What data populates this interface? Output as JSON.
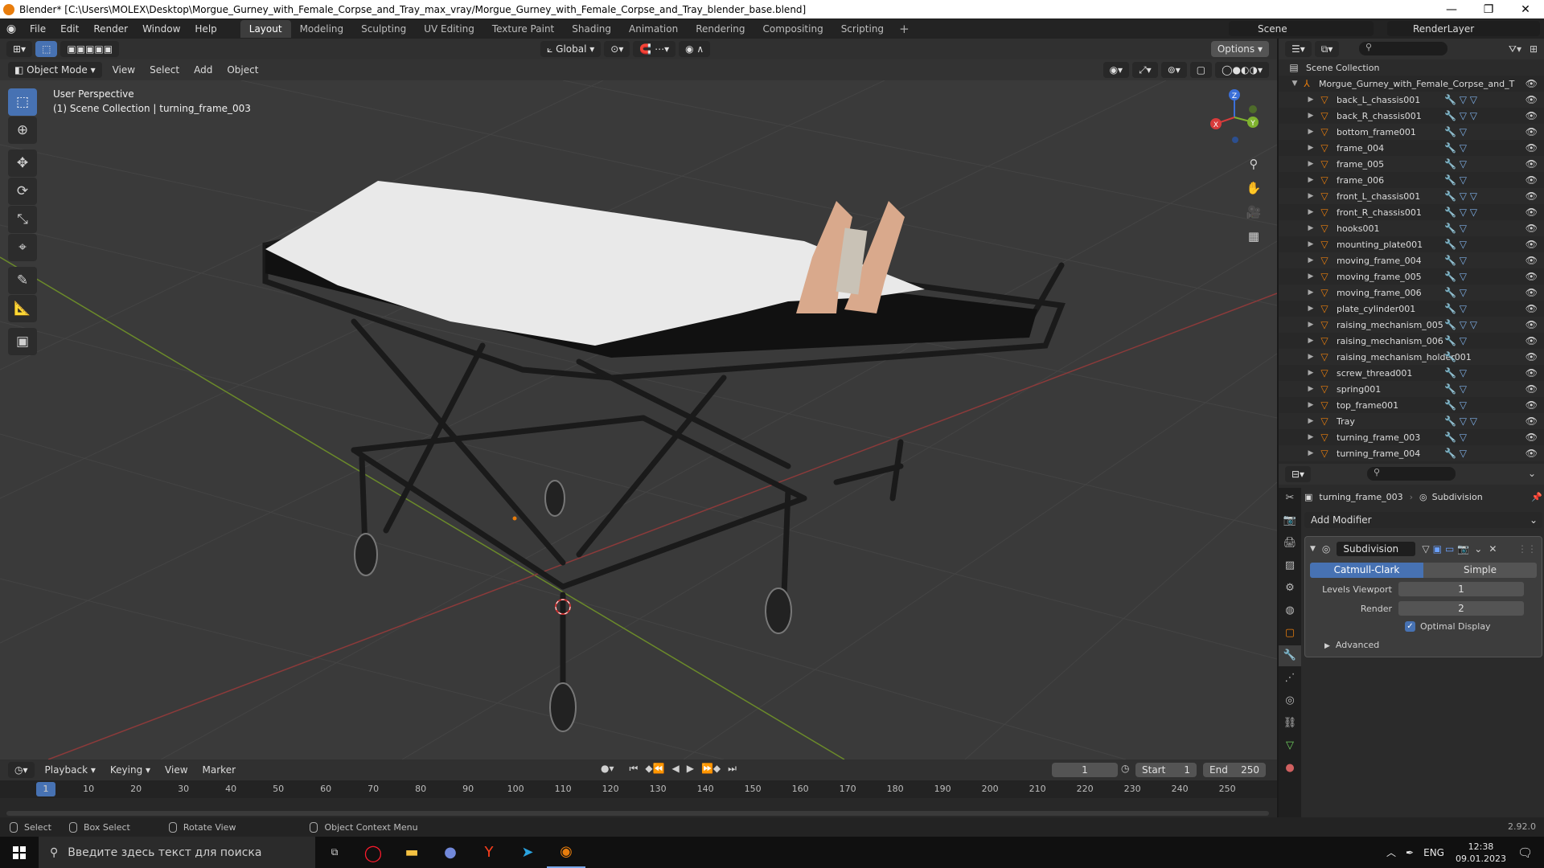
{
  "window": {
    "title": "Blender* [C:\\Users\\MOLEX\\Desktop\\Morgue_Gurney_with_Female_Corpse_and_Tray_max_vray/Morgue_Gurney_with_Female_Corpse_and_Tray_blender_base.blend]",
    "minimize": "—",
    "maximize": "❐",
    "close": "✕"
  },
  "menu": [
    "File",
    "Edit",
    "Render",
    "Window",
    "Help"
  ],
  "workspaces": [
    "Layout",
    "Modeling",
    "Sculpting",
    "UV Editing",
    "Texture Paint",
    "Shading",
    "Animation",
    "Rendering",
    "Compositing",
    "Scripting"
  ],
  "scene": "Scene",
  "render_layer": "RenderLayer",
  "viewport": {
    "mode": "Object Mode",
    "menus": [
      "View",
      "Select",
      "Add",
      "Object"
    ],
    "transform_orientation": "Global",
    "options": "Options",
    "perspective": "User Perspective",
    "collection_info": "(1) Scene Collection | turning_frame_003"
  },
  "gizmo": {
    "x": "X",
    "y": "Y",
    "z": "Z"
  },
  "outliner": {
    "root": "Scene Collection",
    "collection": "Morgue_Gurney_with_Female_Corpse_and_T",
    "items": [
      {
        "name": "back_L_chassis001",
        "mods": "🔧 ▽ ▽"
      },
      {
        "name": "back_R_chassis001",
        "mods": "🔧 ▽ ▽"
      },
      {
        "name": "bottom_frame001",
        "mods": "🔧 ▽"
      },
      {
        "name": "frame_004",
        "mods": "🔧 ▽"
      },
      {
        "name": "frame_005",
        "mods": "🔧 ▽"
      },
      {
        "name": "frame_006",
        "mods": "🔧 ▽"
      },
      {
        "name": "front_L_chassis001",
        "mods": "🔧 ▽ ▽"
      },
      {
        "name": "front_R_chassis001",
        "mods": "🔧 ▽ ▽"
      },
      {
        "name": "hooks001",
        "mods": "🔧 ▽"
      },
      {
        "name": "mounting_plate001",
        "mods": "🔧 ▽"
      },
      {
        "name": "moving_frame_004",
        "mods": "🔧 ▽"
      },
      {
        "name": "moving_frame_005",
        "mods": "🔧 ▽"
      },
      {
        "name": "moving_frame_006",
        "mods": "🔧 ▽"
      },
      {
        "name": "plate_cylinder001",
        "mods": "🔧 ▽"
      },
      {
        "name": "raising_mechanism_005",
        "mods": "🔧 ▽ ▽"
      },
      {
        "name": "raising_mechanism_006",
        "mods": "🔧 ▽"
      },
      {
        "name": "raising_mechanism_holder001",
        "mods": "🔧"
      },
      {
        "name": "screw_thread001",
        "mods": "🔧 ▽"
      },
      {
        "name": "spring001",
        "mods": "🔧 ▽"
      },
      {
        "name": "top_frame001",
        "mods": "🔧 ▽"
      },
      {
        "name": "Tray",
        "mods": "🔧 ▽ ▽"
      },
      {
        "name": "turning_frame_003",
        "mods": "🔧 ▽"
      },
      {
        "name": "turning_frame_004",
        "mods": "🔧 ▽"
      }
    ]
  },
  "properties": {
    "object": "turning_frame_003",
    "modifier_crumb": "Subdivision",
    "add_modifier": "Add Modifier",
    "modifier_name": "Subdivision",
    "catmull": "Catmull-Clark",
    "simple": "Simple",
    "levels_viewport_label": "Levels Viewport",
    "levels_viewport": "1",
    "render_label": "Render",
    "render": "2",
    "optimal_display": "Optimal Display",
    "advanced": "Advanced"
  },
  "timeline": {
    "menus": [
      "Playback",
      "Keying",
      "View",
      "Marker"
    ],
    "current_frame": "1",
    "start_label": "Start",
    "start": "1",
    "end_label": "End",
    "end": "250",
    "ticks": [
      "1",
      "10",
      "20",
      "30",
      "40",
      "50",
      "60",
      "70",
      "80",
      "90",
      "100",
      "110",
      "120",
      "130",
      "140",
      "150",
      "160",
      "170",
      "180",
      "190",
      "200",
      "210",
      "220",
      "230",
      "240",
      "250"
    ]
  },
  "status": {
    "select": "Select",
    "box_select": "Box Select",
    "rotate_view": "Rotate View",
    "context_menu": "Object Context Menu",
    "version": "2.92.0"
  },
  "taskbar": {
    "search_placeholder": "Введите здесь текст для поиска",
    "lang": "ENG",
    "time": "12:38",
    "date": "09.01.2023"
  },
  "colors": {
    "accent": "#4772b3",
    "orange": "#e87d0d",
    "grid_x": "#8c3a3a",
    "grid_y": "#6b8a2a"
  }
}
